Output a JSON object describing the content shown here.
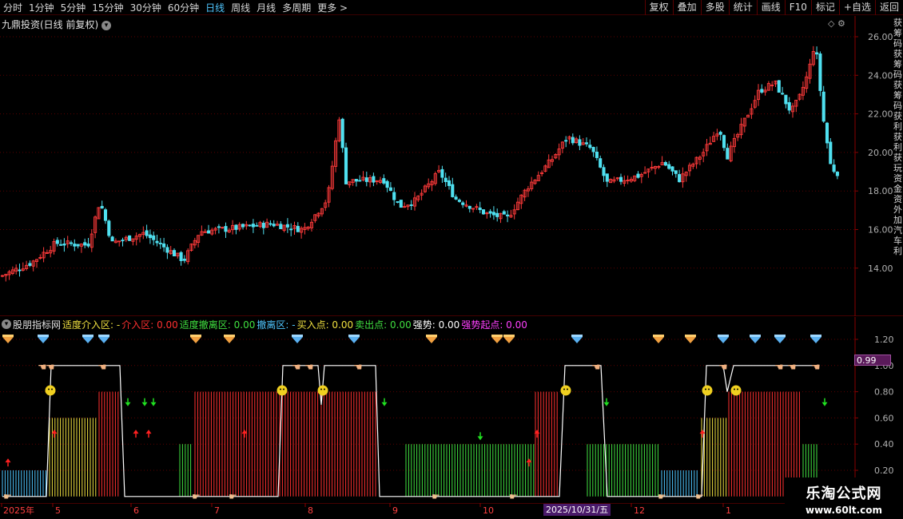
{
  "toolbar": {
    "left": [
      "分时",
      "1分钟",
      "5分钟",
      "15分钟",
      "30分钟",
      "60分钟",
      "日线",
      "周线",
      "月线",
      "多周期",
      "更多 >"
    ],
    "active": "日线",
    "right": [
      "复权",
      "叠加",
      "多股",
      "统计",
      "画线",
      "F10",
      "标记",
      "+自选",
      "返回"
    ]
  },
  "main": {
    "stock_title": "九鼎投资(日线 前复权)",
    "y_ticks": [
      "26.00",
      "24.00",
      "22.00",
      "20.00",
      "18.00",
      "16.00",
      "14.00"
    ]
  },
  "indicator": {
    "name": "股朋指标网",
    "legend": [
      {
        "text": "适度介入区: -",
        "color": "#f0e040"
      },
      {
        "text": "介入区: 0.00",
        "color": "#ff3030"
      },
      {
        "text": "适度撤离区: 0.00",
        "color": "#40e040"
      },
      {
        "text": "撤离区: -",
        "color": "#4fc6ff"
      },
      {
        "text": "买入点: 0.00",
        "color": "#f0e040"
      },
      {
        "text": "卖出点: 0.00",
        "color": "#40e040"
      },
      {
        "text": "强势: 0.00",
        "color": "#ffffff"
      },
      {
        "text": "强势起点: 0.00",
        "color": "#ff40ff"
      }
    ],
    "y_ticks": [
      "1.20",
      "1.00",
      "0.80",
      "0.60",
      "0.40",
      "0.20"
    ],
    "current_value": "0.99"
  },
  "date_axis": {
    "labels": [
      "2025年",
      "5",
      "6",
      "7",
      "8",
      "9",
      "10",
      "12",
      "1"
    ],
    "cursor": "2025/10/31/五"
  },
  "side_text": "获筹码获筹码获筹码获利获利获玩资金资外加汽车利",
  "watermark": {
    "line1": "乐淘公式网",
    "line2": "www.60lt.com"
  },
  "colors": {
    "up": "#ff3a3a",
    "down": "#4fe0f0",
    "grid": "#5a0000",
    "axis": "#8a0000"
  }
}
